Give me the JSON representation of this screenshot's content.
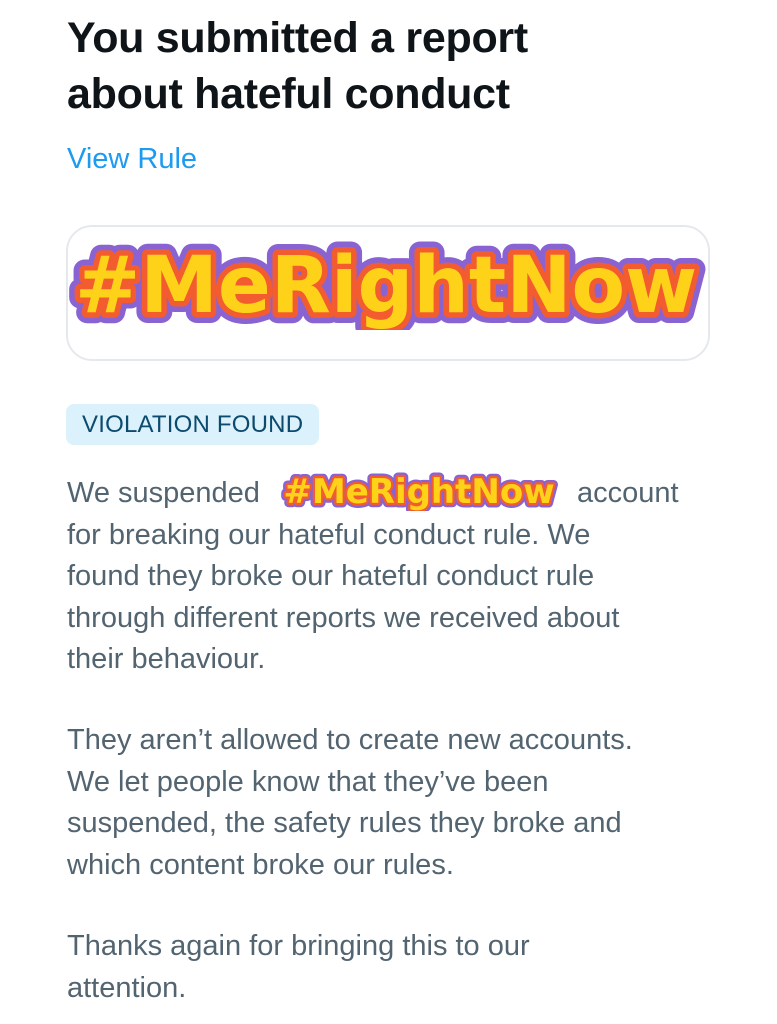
{
  "report": {
    "title_line1": "You submitted a report",
    "title_line2": "about hateful conduct",
    "view_rule_label": "View Rule"
  },
  "reported_account": {
    "sticker_text": "#MeRightNow"
  },
  "status_badge": "VIOLATION FOUND",
  "message": {
    "p1_before": "We suspended",
    "p1_sticker": "#MeRightNow",
    "p1_line1_after": "account",
    "p1_line2": "for breaking our hateful conduct rule. We",
    "p1_line3": "found they broke our hateful conduct rule",
    "p1_line4": "through different reports we received about",
    "p1_line5": "their behaviour.",
    "p2_line1": "They aren’t allowed to create new accounts.",
    "p2_line2": "We let people know that they’ve been",
    "p2_line3": "suspended, the safety rules they broke and",
    "p2_line4": "which content broke our rules.",
    "p3_line1": "Thanks again for bringing this to our",
    "p3_line2": "attention."
  },
  "colors": {
    "link": "#1d9bf0",
    "title": "#0f1419",
    "body_text": "#536471",
    "badge_bg": "#dbf1fb",
    "badge_text": "#0c4a6e",
    "sticker_fill": "#ffd21a",
    "sticker_inner_stroke": "#f25c2e",
    "sticker_outer_stroke": "#8a63d2"
  }
}
